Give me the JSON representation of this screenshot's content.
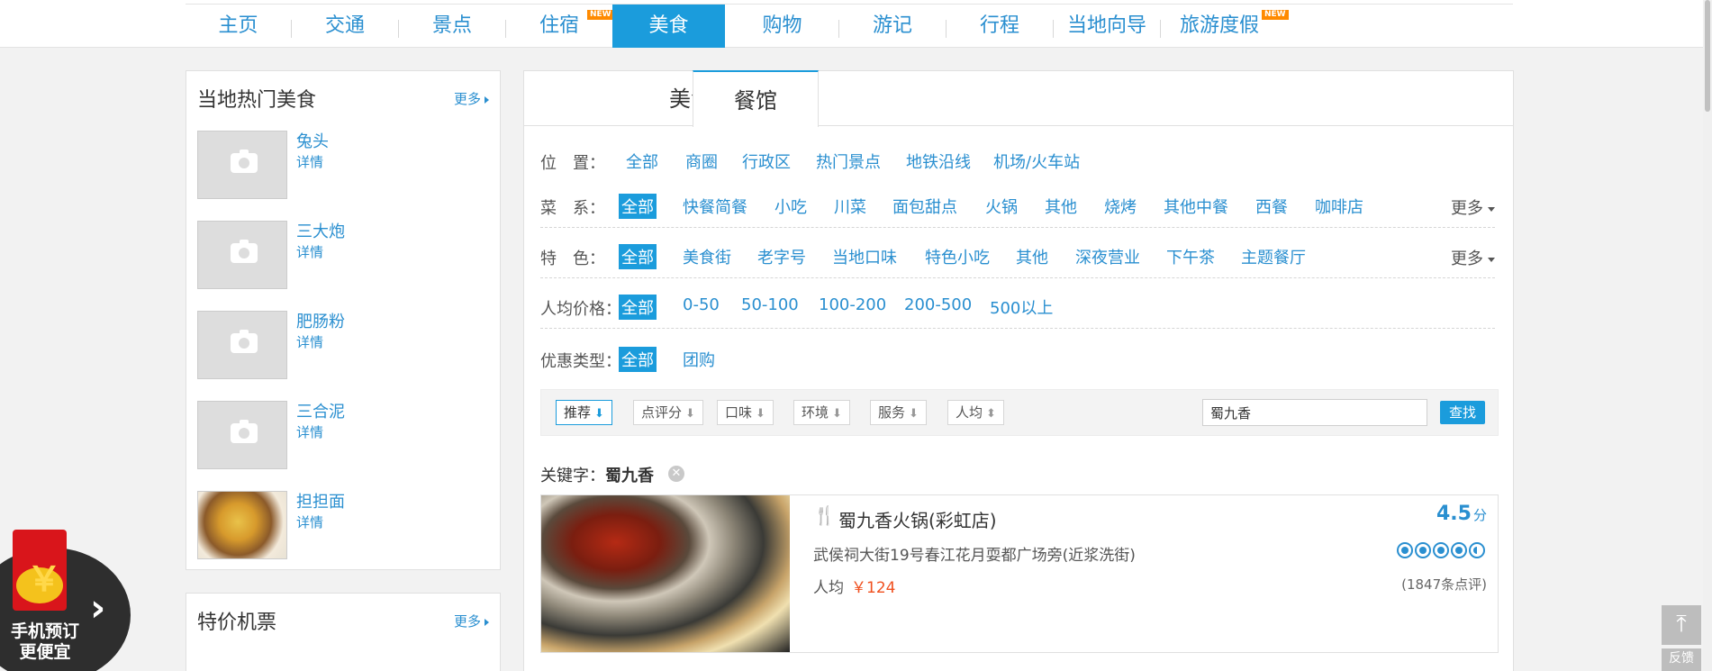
{
  "nav": {
    "items": [
      {
        "label": "主页",
        "name": "home"
      },
      {
        "label": "交通",
        "name": "transport"
      },
      {
        "label": "景点",
        "name": "attractions"
      },
      {
        "label": "住宿",
        "name": "hotel",
        "badge": "NEW"
      },
      {
        "label": "美食",
        "name": "food",
        "active": true
      },
      {
        "label": "购物",
        "name": "shopping"
      },
      {
        "label": "游记",
        "name": "travelogue"
      },
      {
        "label": "行程",
        "name": "itinerary"
      },
      {
        "label": "当地向导",
        "name": "local-guide"
      },
      {
        "label": "旅游度假",
        "name": "vacation",
        "badge": "NEW"
      }
    ]
  },
  "sidebar": {
    "hot_food": {
      "title": "当地热门美食",
      "more": "更多",
      "items": [
        {
          "name": "兔头",
          "detail": "详情"
        },
        {
          "name": "三大炮",
          "detail": "详情"
        },
        {
          "name": "肥肠粉",
          "detail": "详情"
        },
        {
          "name": "三合泥",
          "detail": "详情"
        },
        {
          "name": "担担面",
          "detail": "详情"
        }
      ]
    },
    "flights": {
      "title": "特价机票",
      "more": "更多"
    }
  },
  "tabs": {
    "food": "美食",
    "restaurant": "餐馆"
  },
  "filters": {
    "location": {
      "label": "位　置：",
      "options": [
        "全部",
        "商圈",
        "行政区",
        "热门景点",
        "地铁沿线",
        "机场/火车站"
      ]
    },
    "cuisine": {
      "label": "菜　系：",
      "options": [
        "全部",
        "快餐简餐",
        "小吃",
        "川菜",
        "面包甜点",
        "火锅",
        "其他",
        "烧烤",
        "其他中餐",
        "西餐",
        "咖啡店"
      ],
      "selected": "全部",
      "more": "更多"
    },
    "feature": {
      "label": "特　色：",
      "options": [
        "全部",
        "美食街",
        "老字号",
        "当地口味",
        "特色小吃",
        "其他",
        "深夜营业",
        "下午茶",
        "主题餐厅"
      ],
      "selected": "全部",
      "more": "更多"
    },
    "price": {
      "label": "人均价格：",
      "options": [
        "全部",
        "0-50",
        "50-100",
        "100-200",
        "200-500",
        "500以上"
      ],
      "selected": "全部"
    },
    "discount": {
      "label": "优惠类型：",
      "options": [
        "全部",
        "团购"
      ],
      "selected": "全部"
    }
  },
  "sort": {
    "buttons": [
      "推荐",
      "点评分",
      "口味",
      "环境",
      "服务",
      "人均"
    ],
    "active": "推荐",
    "search_value": "蜀九香",
    "search_button": "查找"
  },
  "keyword": {
    "label": "关键字：",
    "value": "蜀九香"
  },
  "result": {
    "name": "蜀九香火锅(彩虹店)",
    "address": "武侯祠大街19号春江花月耍都广场旁(近浆洗街)",
    "avg_label": "人均",
    "avg_price": "￥124",
    "score": "4.5",
    "score_unit": "分",
    "rating": 4.5,
    "reviews": "(1847条点评)"
  },
  "promo": {
    "yen": "￥",
    "text_line1": "手机预订",
    "text_line2": "更便宜"
  },
  "tools": {
    "to_top": "⤒",
    "feedback": "反馈"
  },
  "colors": {
    "accent": "#1b9cdc",
    "link": "#2a8fd0",
    "price": "#f0501f",
    "badge": "#ff8a00"
  }
}
